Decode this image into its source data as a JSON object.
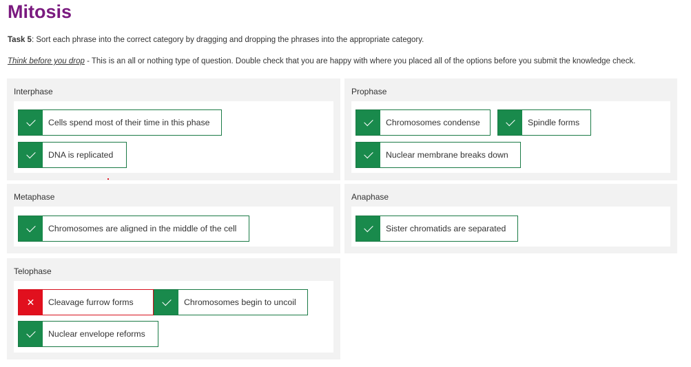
{
  "title": "Mitosis",
  "task": {
    "label": "Task 5",
    "text": ": Sort each phrase into the correct category by dragging and dropping the phrases into the appropriate category."
  },
  "think": {
    "emph": "Think before you drop",
    "text": " - This is an all or nothing type of question. Double check that you are happy with where you placed all of the options before you submit the knowledge check."
  },
  "colors": {
    "title": "#7a1a7f",
    "correct": "#198a4c",
    "wrong": "#e1101e",
    "panel": "#f2f2f2"
  },
  "categories": [
    {
      "name": "Interphase",
      "items": [
        {
          "text": "Cells spend most of their time in this phase",
          "status": "correct",
          "icon": "check-icon"
        },
        {
          "text": "DNA is replicated",
          "status": "correct",
          "icon": "check-icon"
        }
      ]
    },
    {
      "name": "Prophase",
      "items": [
        {
          "text": "Chromosomes condense",
          "status": "correct",
          "icon": "check-icon"
        },
        {
          "text": "Spindle forms",
          "status": "correct",
          "icon": "check-icon"
        },
        {
          "text": "Nuclear membrane breaks down",
          "status": "correct",
          "icon": "check-icon"
        }
      ]
    },
    {
      "name": "Metaphase",
      "items": [
        {
          "text": "Chromosomes are aligned in the middle of the cell",
          "status": "correct",
          "icon": "check-icon"
        }
      ]
    },
    {
      "name": "Anaphase",
      "items": [
        {
          "text": "Sister chromatids are separated",
          "status": "correct",
          "icon": "check-icon"
        }
      ]
    },
    {
      "name": "Telophase",
      "items": [
        {
          "text": "Cleavage furrow forms",
          "status": "wrong",
          "icon": "cross-icon"
        },
        {
          "text": "Chromosomes begin to uncoil",
          "status": "correct",
          "icon": "check-icon"
        },
        {
          "text": "Nuclear envelope reforms",
          "status": "correct",
          "icon": "check-icon"
        }
      ]
    }
  ]
}
